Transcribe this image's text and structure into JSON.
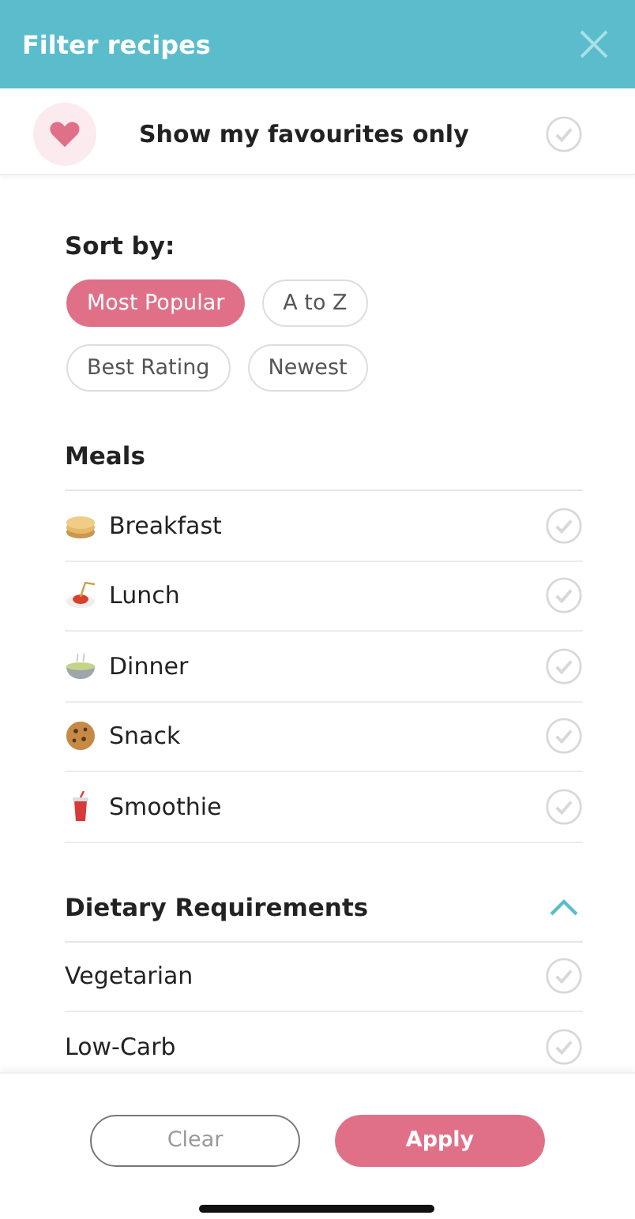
{
  "header": {
    "title": "Filter recipes"
  },
  "favourites": {
    "label": "Show my favourites only",
    "checked": false
  },
  "sort": {
    "title": "Sort by:",
    "options": [
      {
        "label": "Most Popular",
        "selected": true
      },
      {
        "label": "A to Z",
        "selected": false
      },
      {
        "label": "Best Rating",
        "selected": false
      },
      {
        "label": "Newest",
        "selected": false
      }
    ]
  },
  "sections": [
    {
      "title": "Meals",
      "items": [
        {
          "label": "Breakfast",
          "kind": "pancakes",
          "checked": false
        },
        {
          "label": "Lunch",
          "kind": "pasta",
          "checked": false
        },
        {
          "label": "Dinner",
          "kind": "bowl",
          "checked": false
        },
        {
          "label": "Snack",
          "kind": "cookie",
          "checked": false
        },
        {
          "label": "Smoothie",
          "kind": "cup",
          "checked": false
        }
      ]
    },
    {
      "title": "Dietary Requirements",
      "expanded": true,
      "items": [
        {
          "label": "Vegetarian",
          "checked": false
        },
        {
          "label": "Low-Carb",
          "checked": false
        }
      ]
    }
  ],
  "footer": {
    "clear": "Clear",
    "apply": "Apply"
  }
}
